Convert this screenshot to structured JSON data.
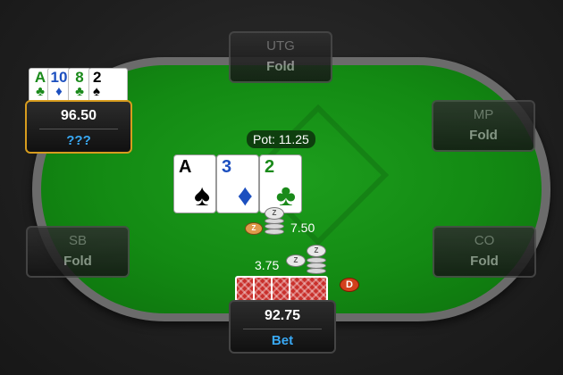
{
  "seats": {
    "utg": {
      "position": "UTG",
      "action": "Fold"
    },
    "mp": {
      "position": "MP",
      "action": "Fold"
    },
    "sb": {
      "position": "SB",
      "action": "Fold"
    },
    "co": {
      "position": "CO",
      "action": "Fold"
    }
  },
  "opponent": {
    "stack": "96.50",
    "status": "???",
    "cards": [
      {
        "rank": "A",
        "suit": "♣",
        "color": "#1a8a1a"
      },
      {
        "rank": "10",
        "suit": "♦",
        "color": "#1c4fbf"
      },
      {
        "rank": "8",
        "suit": "♣",
        "color": "#1a8a1a"
      },
      {
        "rank": "2",
        "suit": "♠",
        "color": "#000000"
      }
    ]
  },
  "hero": {
    "stack": "92.75",
    "status": "Bet",
    "bet": "3.75"
  },
  "board": {
    "cards": [
      {
        "rank": "A",
        "suit": "♠",
        "color": "#000000"
      },
      {
        "rank": "3",
        "suit": "♦",
        "color": "#1c4fbf"
      },
      {
        "rank": "2",
        "suit": "♣",
        "color": "#1a8a1a"
      }
    ]
  },
  "pot_label": "Pot: 11.25",
  "opponent_bet": "7.50",
  "dealer_button": "D",
  "colors": {
    "felt": "#138a13",
    "highlight": "#d79c1e",
    "status_blue": "#39a9f5"
  }
}
